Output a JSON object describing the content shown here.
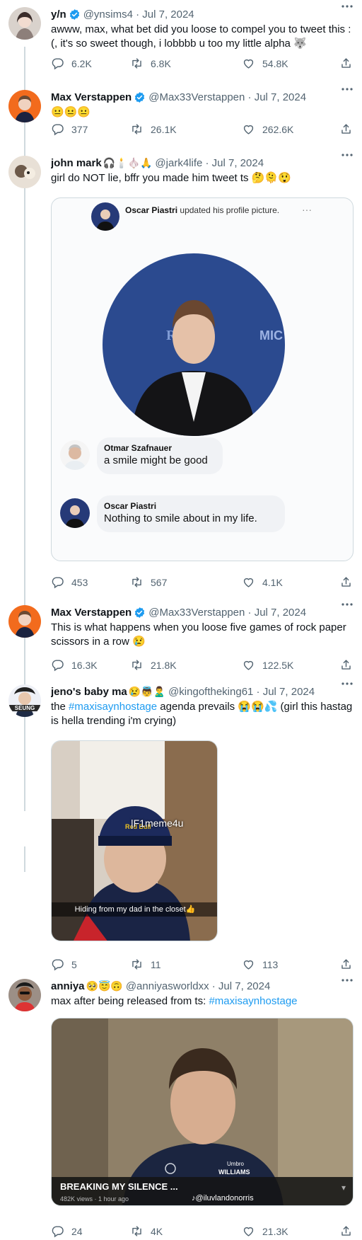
{
  "colors": {
    "accent": "#1d9bf0",
    "secondary_text": "#536471",
    "border": "#cfd9de"
  },
  "tweets": [
    {
      "name": "y/n",
      "handle": "@ynsims4 · Jul 7, 2024",
      "text": "awww, max, what bet did you loose to compel you to tweet this :(, it's so sweet though, i lobbbb u too my little alpha 🐺",
      "replies": "6.2K",
      "retweets": "6.8K",
      "likes": "54.8K"
    },
    {
      "name": "Max Verstappen",
      "handle": "@Max33Verstappen · Jul 7, 2024",
      "text": "😐😐😐",
      "replies": "377",
      "retweets": "26.1K",
      "likes": "262.6K"
    },
    {
      "name": "john mark",
      "name_emoji": "🎧🕯️🧄🙏",
      "handle": "@jark4life · Jul 7, 2024",
      "text": "girl do NOT lie, bffr you made him tweet ts 🤔🫠😲",
      "replies": "453",
      "retweets": "567",
      "likes": "4.1K",
      "embed": {
        "author": "Oscar Piastri",
        "action": "updated his profile picture.",
        "comment1_author": "Otmar Szafnauer",
        "comment1_text": "a smile might be good",
        "comment2_author": "Oscar Piastri",
        "comment2_text": "Nothing to smile about in my life."
      }
    },
    {
      "name": "Max Verstappen",
      "handle": "@Max33Verstappen · Jul 7, 2024",
      "text": "This is what happens when you loose five games of rock paper scissors in a row 😢",
      "replies": "16.3K",
      "retweets": "21.8K",
      "likes": "122.5K"
    },
    {
      "name": "jeno's baby ma",
      "name_emoji": "😢👼🙎‍♂️",
      "handle": "@kingoftheking61 · Jul 7, 2024",
      "text_before": "the ",
      "hashtag": "#maxisaynhostage",
      "text_after": " agenda prevails 😭😭💦 (girl this hastag is hella trending i'm crying)",
      "replies": "5",
      "retweets": "11",
      "likes": "113",
      "avatar_badge": "SEUNG",
      "image": {
        "watermark": "|F1meme4u",
        "caption": "Hiding from my dad in the closet👍"
      }
    },
    {
      "name": "anniya",
      "name_emoji": "🥺😇🙃",
      "handle": "@anniyasworldxx · Jul 7, 2024",
      "text_before": "max after being released from ts: ",
      "hashtag": "#maxisaynhostage",
      "replies": "24",
      "retweets": "4K",
      "likes": "21.3K",
      "video": {
        "title": "BREAKING MY SILENCE ...",
        "meta": "482K views · 1 hour ago",
        "credit": "@iluvlandonorris",
        "shirt_text": "WILLIAMS"
      }
    }
  ]
}
